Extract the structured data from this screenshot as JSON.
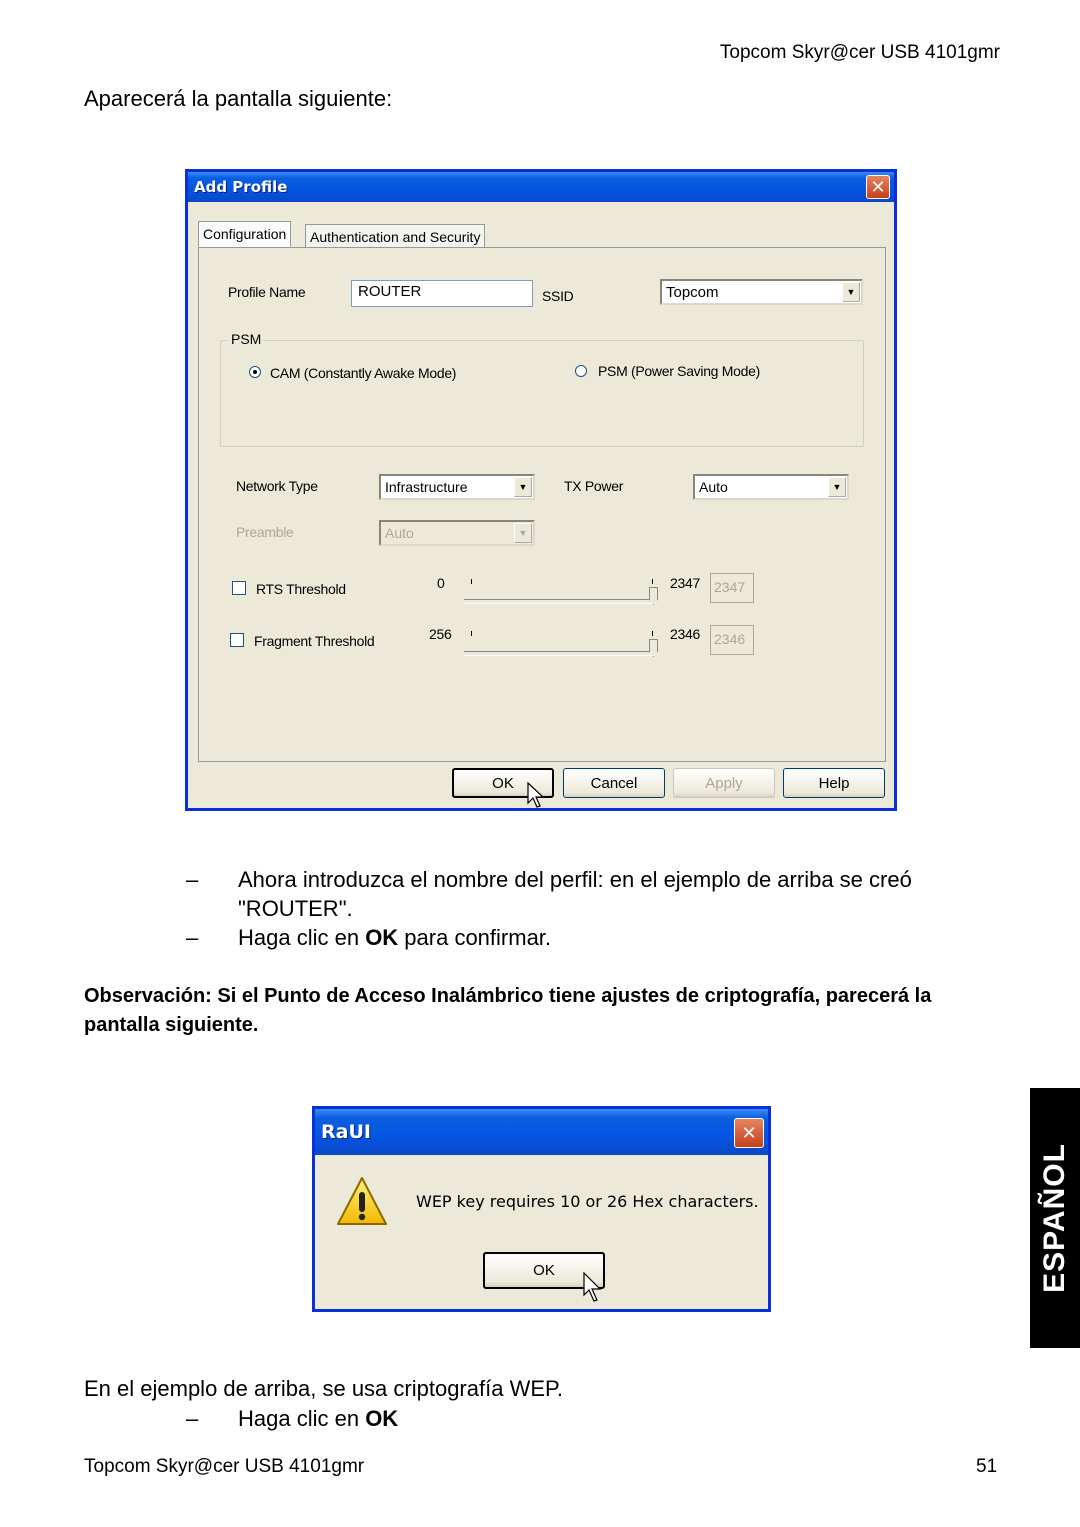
{
  "page": {
    "header": "Topcom Skyr@cer USB 4101gmr",
    "intro": "Aparecerá la pantalla siguiente:",
    "bullets": [
      {
        "dash": "–",
        "text": "Ahora introduzca el nombre del perfil: en el ejemplo de arriba se creó \"ROUTER\"."
      },
      {
        "dash": "–",
        "text_before": "Haga clic en ",
        "bold": "OK",
        "text_after": " para confirmar."
      }
    ],
    "observation": "Observación: Si el Punto de Acceso Inalámbrico tiene ajustes de criptografía, parecerá la pantalla siguiente.",
    "after_text": "En el ejemplo de arriba, se usa criptografía WEP.",
    "last_bullet": {
      "dash": "–",
      "text_before": "Haga clic en ",
      "bold": "OK"
    },
    "footer_left": "Topcom Skyr@cer USB 4101gmr",
    "page_number": "51",
    "side_tab": "ESPAÑOL"
  },
  "add_profile": {
    "title": "Add Profile",
    "close": "✕",
    "tabs": [
      "Configuration",
      "Authentication and Security"
    ],
    "profile_name_label": "Profile Name",
    "profile_name_value": "ROUTER",
    "ssid_label": "SSID",
    "ssid_value": "Topcom",
    "psm_group": "PSM",
    "radio_cam": "CAM (Constantly Awake Mode)",
    "radio_psm": "PSM (Power Saving Mode)",
    "network_type_label": "Network Type",
    "network_type_value": "Infrastructure",
    "tx_power_label": "TX Power",
    "tx_power_value": "Auto",
    "preamble_label": "Preamble",
    "preamble_value": "Auto",
    "rts": {
      "label": "RTS Threshold",
      "min": "0",
      "max": "2347",
      "value": "2347"
    },
    "frag": {
      "label": "Fragment Threshold",
      "min": "256",
      "max": "2346",
      "value": "2346"
    },
    "buttons": {
      "ok": "OK",
      "cancel": "Cancel",
      "apply": "Apply",
      "help": "Help"
    }
  },
  "raui": {
    "title": "RaUI",
    "close": "✕",
    "message": "WEP key requires 10 or 26 Hex characters.",
    "ok": "OK"
  }
}
